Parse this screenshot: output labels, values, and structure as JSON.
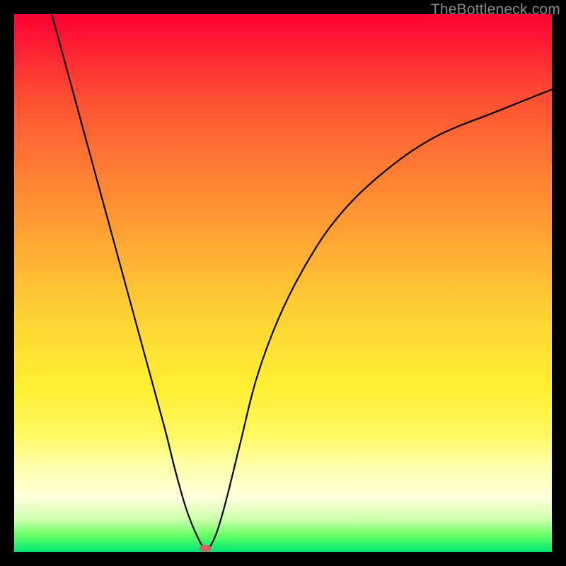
{
  "watermark": "TheBottleneck.com",
  "chart_data": {
    "type": "line",
    "title": "",
    "xlabel": "",
    "ylabel": "",
    "x_range": [
      0,
      100
    ],
    "y_range": [
      0,
      100
    ],
    "series": [
      {
        "name": "curve",
        "x": [
          7,
          10,
          13,
          16,
          19,
          22,
          25,
          28,
          30,
          32,
          34,
          35.5,
          37,
          39,
          42,
          45,
          49,
          54,
          60,
          68,
          78,
          90,
          100
        ],
        "y": [
          100,
          89,
          78,
          67,
          56,
          45,
          34,
          23,
          15,
          8,
          3,
          0.7,
          2,
          8,
          20,
          32,
          43,
          53,
          62,
          70,
          77,
          82,
          86
        ]
      }
    ],
    "marker": {
      "x": 35.5,
      "y": 0.7,
      "color": "#c86464",
      "width_pct": 2.2,
      "height_pct": 1.3
    },
    "gradient": {
      "top": "#ff0033",
      "mid": "#ffe033",
      "bottom": "#00e676"
    }
  }
}
